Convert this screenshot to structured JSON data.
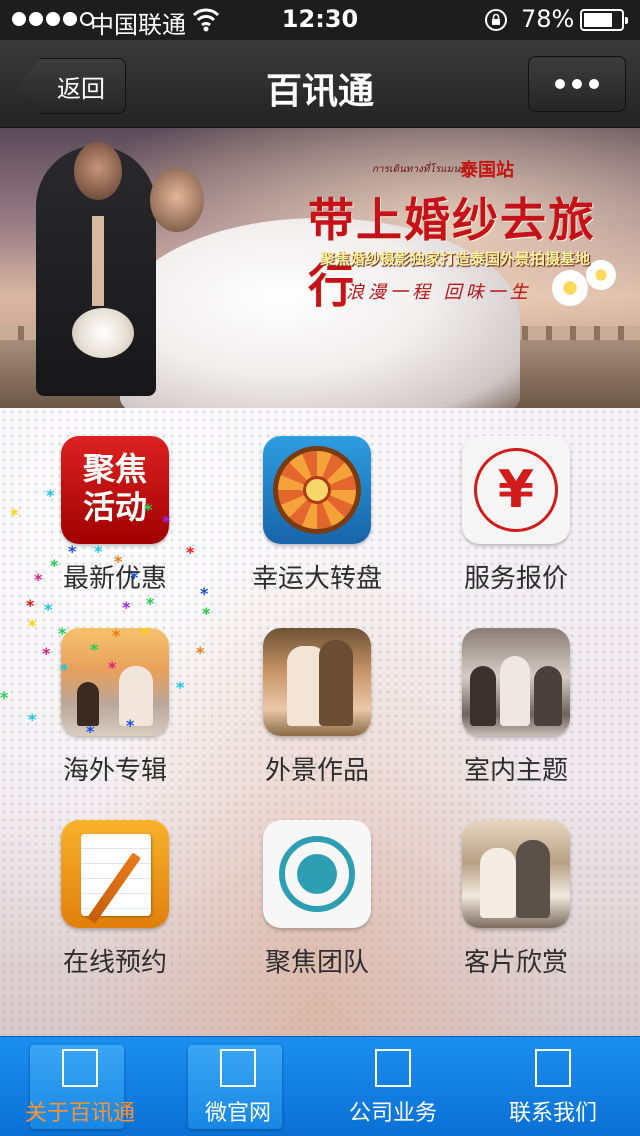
{
  "status_bar": {
    "carrier": "中国联通",
    "time": "12:30",
    "battery_percent": "78%",
    "battery_level": 0.78
  },
  "nav": {
    "back_label": "返回",
    "title": "百讯通",
    "more_icon": "ellipsis-icon"
  },
  "banner": {
    "small_line": "การเดินทางที่โรแมนติก",
    "place": "泰国站",
    "headline": "带上婚纱去旅行",
    "subhead": "聚焦婚纱摄影独家打造泰国外景拍摄基地",
    "slogan": "浪漫一程  回味一生"
  },
  "grid": {
    "items": [
      {
        "label": "最新优惠",
        "icon": "promo-icon",
        "icon_text": "聚焦\n活动"
      },
      {
        "label": "幸运大转盘",
        "icon": "lucky-wheel-icon"
      },
      {
        "label": "服务报价",
        "icon": "yen-icon",
        "icon_text": "¥"
      },
      {
        "label": "海外专辑",
        "icon": "overseas-album-icon"
      },
      {
        "label": "外景作品",
        "icon": "outdoor-works-icon"
      },
      {
        "label": "室内主题",
        "icon": "indoor-theme-icon"
      },
      {
        "label": "在线预约",
        "icon": "booking-icon"
      },
      {
        "label": "聚焦团队",
        "icon": "team-icon"
      },
      {
        "label": "客片欣赏",
        "icon": "client-photos-icon"
      }
    ]
  },
  "tabbar": {
    "items": [
      {
        "label": "关于百讯通",
        "icon": "square-icon"
      },
      {
        "label": "微官网",
        "icon": "square-icon"
      },
      {
        "label": "公司业务",
        "icon": "square-icon"
      },
      {
        "label": "联系我们",
        "icon": "square-icon"
      }
    ]
  },
  "colors": {
    "tabbar": "#0a70d4",
    "active_tab_label": "#ff9130",
    "banner_headline": "#c5121a"
  }
}
